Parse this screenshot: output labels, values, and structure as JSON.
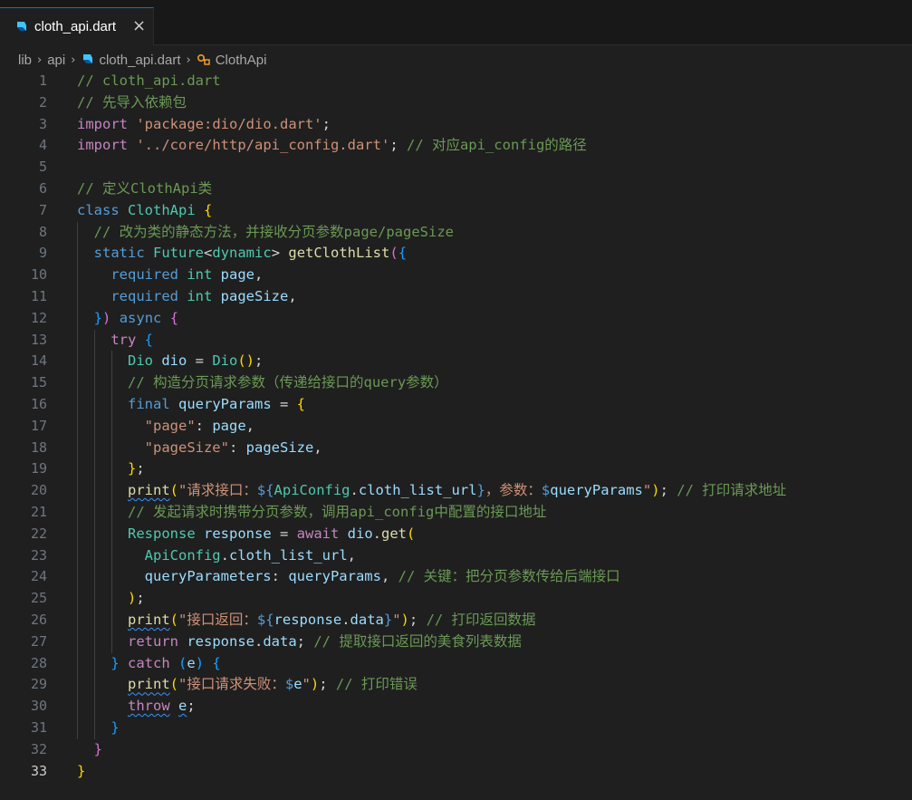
{
  "tab": {
    "label": "cloth_api.dart",
    "close": "×"
  },
  "breadcrumb": {
    "items": [
      "lib",
      "api",
      "cloth_api.dart",
      "ClothApi"
    ]
  },
  "editor": {
    "active_line": 33,
    "lines": [
      {
        "n": "1",
        "tokens": [
          [
            "// cloth_api.dart",
            "c"
          ]
        ]
      },
      {
        "n": "2",
        "tokens": [
          [
            "// 先导入依赖包",
            "c"
          ]
        ]
      },
      {
        "n": "3",
        "tokens": [
          [
            "import",
            "k2"
          ],
          [
            " ",
            "p"
          ],
          [
            "'package:dio/dio.dart'",
            "s"
          ],
          [
            ";",
            "p"
          ]
        ]
      },
      {
        "n": "4",
        "tokens": [
          [
            "import",
            "k2"
          ],
          [
            " ",
            "p"
          ],
          [
            "'../core/http/api_config.dart'",
            "s"
          ],
          [
            "; ",
            "p"
          ],
          [
            "// 对应api_config的路径",
            "c"
          ]
        ]
      },
      {
        "n": "5",
        "tokens": []
      },
      {
        "n": "6",
        "tokens": [
          [
            "// 定义ClothApi类",
            "c"
          ]
        ]
      },
      {
        "n": "7",
        "tokens": [
          [
            "class",
            "k"
          ],
          [
            " ",
            "p"
          ],
          [
            "ClothApi",
            "t"
          ],
          [
            " ",
            "p"
          ],
          [
            "{",
            "b1"
          ]
        ]
      },
      {
        "n": "8",
        "tokens": [
          [
            "  ",
            "p"
          ],
          [
            "// 改为类的静态方法，并接收分页参数page/pageSize",
            "c"
          ]
        ]
      },
      {
        "n": "9",
        "tokens": [
          [
            "  ",
            "p"
          ],
          [
            "static",
            "k"
          ],
          [
            " ",
            "p"
          ],
          [
            "Future",
            "t"
          ],
          [
            "<",
            "p"
          ],
          [
            "dynamic",
            "t"
          ],
          [
            "> ",
            "p"
          ],
          [
            "getClothList",
            "f"
          ],
          [
            "(",
            "b2"
          ],
          [
            "{",
            "b3"
          ]
        ]
      },
      {
        "n": "10",
        "tokens": [
          [
            "    ",
            "p"
          ],
          [
            "required",
            "k"
          ],
          [
            " ",
            "p"
          ],
          [
            "int",
            "t"
          ],
          [
            " ",
            "p"
          ],
          [
            "page",
            "v"
          ],
          [
            ",",
            "p"
          ]
        ]
      },
      {
        "n": "11",
        "tokens": [
          [
            "    ",
            "p"
          ],
          [
            "required",
            "k"
          ],
          [
            " ",
            "p"
          ],
          [
            "int",
            "t"
          ],
          [
            " ",
            "p"
          ],
          [
            "pageSize",
            "v"
          ],
          [
            ",",
            "p"
          ]
        ]
      },
      {
        "n": "12",
        "tokens": [
          [
            "  ",
            "p"
          ],
          [
            "}",
            "b3"
          ],
          [
            ")",
            "b2"
          ],
          [
            " ",
            "p"
          ],
          [
            "async",
            "k"
          ],
          [
            " ",
            "p"
          ],
          [
            "{",
            "b2"
          ]
        ]
      },
      {
        "n": "13",
        "tokens": [
          [
            "    ",
            "p"
          ],
          [
            "try",
            "k2"
          ],
          [
            " ",
            "p"
          ],
          [
            "{",
            "b3"
          ]
        ]
      },
      {
        "n": "14",
        "tokens": [
          [
            "      ",
            "p"
          ],
          [
            "Dio",
            "t"
          ],
          [
            " ",
            "p"
          ],
          [
            "dio",
            "v"
          ],
          [
            " = ",
            "p"
          ],
          [
            "Dio",
            "t"
          ],
          [
            "()",
            "b1"
          ],
          [
            ";",
            "p"
          ]
        ]
      },
      {
        "n": "15",
        "tokens": [
          [
            "      ",
            "p"
          ],
          [
            "// 构造分页请求参数（传递给接口的query参数）",
            "c"
          ]
        ]
      },
      {
        "n": "16",
        "tokens": [
          [
            "      ",
            "p"
          ],
          [
            "final",
            "k"
          ],
          [
            " ",
            "p"
          ],
          [
            "queryParams",
            "v"
          ],
          [
            " = ",
            "p"
          ],
          [
            "{",
            "b1"
          ]
        ]
      },
      {
        "n": "17",
        "tokens": [
          [
            "        ",
            "p"
          ],
          [
            "\"page\"",
            "s"
          ],
          [
            ": ",
            "p"
          ],
          [
            "page",
            "v"
          ],
          [
            ",",
            "p"
          ]
        ]
      },
      {
        "n": "18",
        "tokens": [
          [
            "        ",
            "p"
          ],
          [
            "\"pageSize\"",
            "s"
          ],
          [
            ": ",
            "p"
          ],
          [
            "pageSize",
            "v"
          ],
          [
            ",",
            "p"
          ]
        ]
      },
      {
        "n": "19",
        "tokens": [
          [
            "      ",
            "p"
          ],
          [
            "}",
            "b1"
          ],
          [
            ";",
            "p"
          ]
        ]
      },
      {
        "n": "20",
        "tokens": [
          [
            "      ",
            "p"
          ],
          [
            "print",
            "fsq"
          ],
          [
            "(",
            "b1"
          ],
          [
            "\"请求接口：",
            "s"
          ],
          [
            "${",
            "k"
          ],
          [
            "ApiConfig",
            "t"
          ],
          [
            ".",
            "p"
          ],
          [
            "cloth_list_url",
            "v"
          ],
          [
            "}",
            "k"
          ],
          [
            "，参数：",
            "s"
          ],
          [
            "$",
            "k"
          ],
          [
            "queryParams",
            "v"
          ],
          [
            "\"",
            "s"
          ],
          [
            ")",
            "b1"
          ],
          [
            "; ",
            "p"
          ],
          [
            "// 打印请求地址",
            "c"
          ]
        ]
      },
      {
        "n": "21",
        "tokens": [
          [
            "      ",
            "p"
          ],
          [
            "// 发起请求时携带分页参数，调用api_config中配置的接口地址",
            "c"
          ]
        ]
      },
      {
        "n": "22",
        "tokens": [
          [
            "      ",
            "p"
          ],
          [
            "Response",
            "t"
          ],
          [
            " ",
            "p"
          ],
          [
            "response",
            "v"
          ],
          [
            " = ",
            "p"
          ],
          [
            "await",
            "k2"
          ],
          [
            " ",
            "p"
          ],
          [
            "dio",
            "v"
          ],
          [
            ".",
            "p"
          ],
          [
            "get",
            "f"
          ],
          [
            "(",
            "b1"
          ]
        ]
      },
      {
        "n": "23",
        "tokens": [
          [
            "        ",
            "p"
          ],
          [
            "ApiConfig",
            "t"
          ],
          [
            ".",
            "p"
          ],
          [
            "cloth_list_url",
            "v"
          ],
          [
            ",",
            "p"
          ]
        ]
      },
      {
        "n": "24",
        "tokens": [
          [
            "        ",
            "p"
          ],
          [
            "queryParameters",
            "v"
          ],
          [
            ": ",
            "p"
          ],
          [
            "queryParams",
            "v"
          ],
          [
            ", ",
            "p"
          ],
          [
            "// 关键：把分页参数传给后端接口",
            "c"
          ]
        ]
      },
      {
        "n": "25",
        "tokens": [
          [
            "      ",
            "p"
          ],
          [
            ")",
            "b1"
          ],
          [
            ";",
            "p"
          ]
        ]
      },
      {
        "n": "26",
        "tokens": [
          [
            "      ",
            "p"
          ],
          [
            "print",
            "fsq"
          ],
          [
            "(",
            "b1"
          ],
          [
            "\"接口返回：",
            "s"
          ],
          [
            "${",
            "k"
          ],
          [
            "response",
            "v"
          ],
          [
            ".",
            "p"
          ],
          [
            "data",
            "v"
          ],
          [
            "}",
            "k"
          ],
          [
            "\"",
            "s"
          ],
          [
            ")",
            "b1"
          ],
          [
            "; ",
            "p"
          ],
          [
            "// 打印返回数据",
            "c"
          ]
        ]
      },
      {
        "n": "27",
        "tokens": [
          [
            "      ",
            "p"
          ],
          [
            "return",
            "k2"
          ],
          [
            " ",
            "p"
          ],
          [
            "response",
            "v"
          ],
          [
            ".",
            "p"
          ],
          [
            "data",
            "v"
          ],
          [
            "; ",
            "p"
          ],
          [
            "// 提取接口返回的美食列表数据",
            "c"
          ]
        ]
      },
      {
        "n": "28",
        "tokens": [
          [
            "    ",
            "p"
          ],
          [
            "}",
            "b3"
          ],
          [
            " ",
            "p"
          ],
          [
            "catch",
            "k2"
          ],
          [
            " ",
            "p"
          ],
          [
            "(",
            "b3"
          ],
          [
            "e",
            "v"
          ],
          [
            ")",
            "b3"
          ],
          [
            " ",
            "p"
          ],
          [
            "{",
            "b3"
          ]
        ]
      },
      {
        "n": "29",
        "tokens": [
          [
            "      ",
            "p"
          ],
          [
            "print",
            "fsq"
          ],
          [
            "(",
            "b1"
          ],
          [
            "\"接口请求失败：",
            "s"
          ],
          [
            "$",
            "k"
          ],
          [
            "e",
            "v"
          ],
          [
            "\"",
            "s"
          ],
          [
            ")",
            "b1"
          ],
          [
            "; ",
            "p"
          ],
          [
            "// 打印错误",
            "c"
          ]
        ]
      },
      {
        "n": "30",
        "tokens": [
          [
            "      ",
            "p"
          ],
          [
            "throw",
            "k2sq"
          ],
          [
            " ",
            "p"
          ],
          [
            "e",
            "vsq"
          ],
          [
            ";",
            "p"
          ]
        ]
      },
      {
        "n": "31",
        "tokens": [
          [
            "    ",
            "p"
          ],
          [
            "}",
            "b3"
          ]
        ]
      },
      {
        "n": "32",
        "tokens": [
          [
            "  ",
            "p"
          ],
          [
            "}",
            "b2"
          ]
        ]
      },
      {
        "n": "33",
        "tokens": [
          [
            "}",
            "b1"
          ]
        ]
      }
    ]
  },
  "colors": {
    "background": "#1f1f1f",
    "accent": "#0078d4"
  }
}
